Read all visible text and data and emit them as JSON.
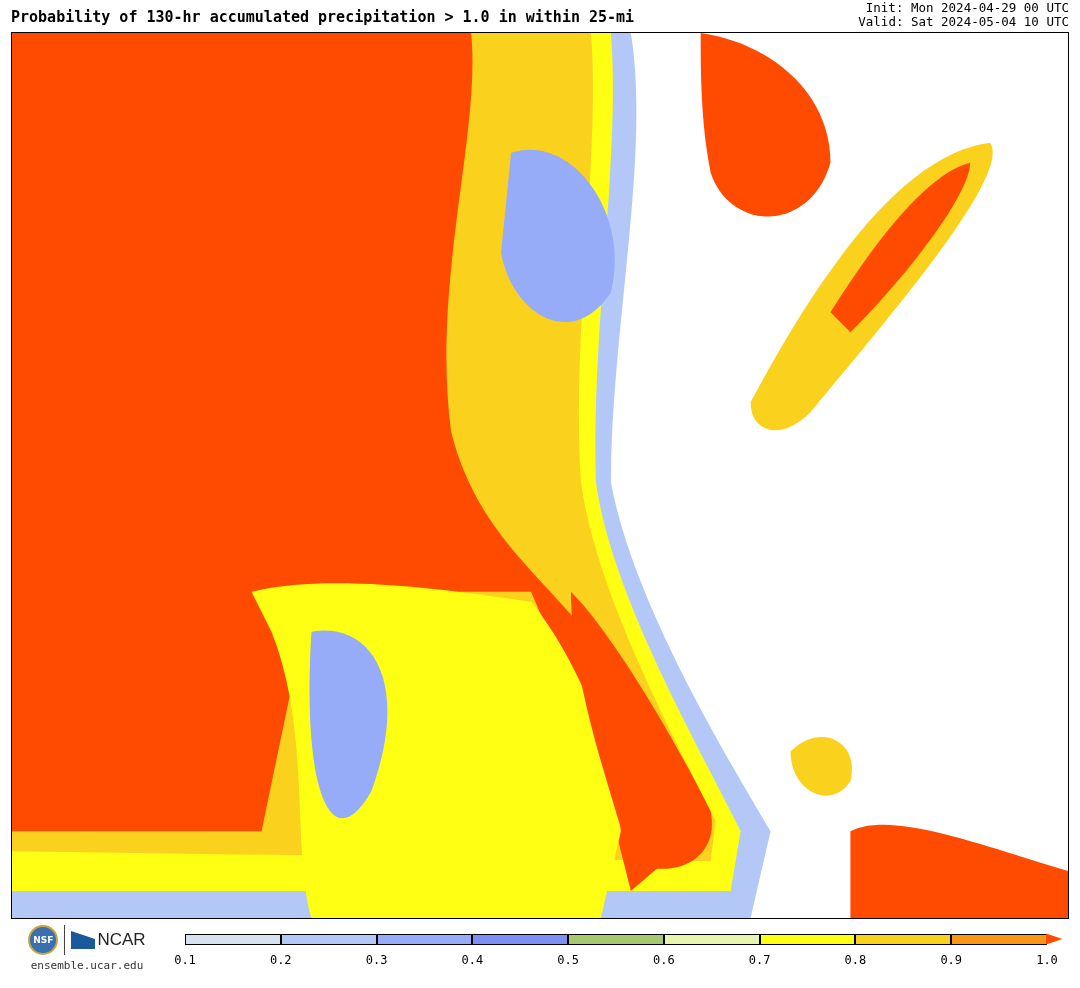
{
  "title": "Probability of 130-hr accumulated precipitation > 1.0 in within 25-mi",
  "init": "Init: Mon 2024-04-29 00 UTC",
  "valid": "Valid: Sat 2024-05-04 10 UTC",
  "logos": {
    "nsf": "NSF",
    "ncar": "NCAR",
    "site": "ensemble.ucar.edu"
  },
  "colorbar": {
    "segments": [
      {
        "color": "#d6e2ee"
      },
      {
        "color": "#b4c8f8"
      },
      {
        "color": "#96acf8"
      },
      {
        "color": "#7d8ff4"
      },
      {
        "color": "#a6c86e"
      },
      {
        "color": "#e6f5b0"
      },
      {
        "color": "#ffff14"
      },
      {
        "color": "#fad21e"
      },
      {
        "color": "#fa9614"
      }
    ],
    "over_arrow": {
      "color": "#ff4b00"
    },
    "ticks": [
      "0.1",
      "0.2",
      "0.3",
      "0.4",
      "0.5",
      "0.6",
      "0.7",
      "0.8",
      "0.9",
      "1.0"
    ]
  }
}
